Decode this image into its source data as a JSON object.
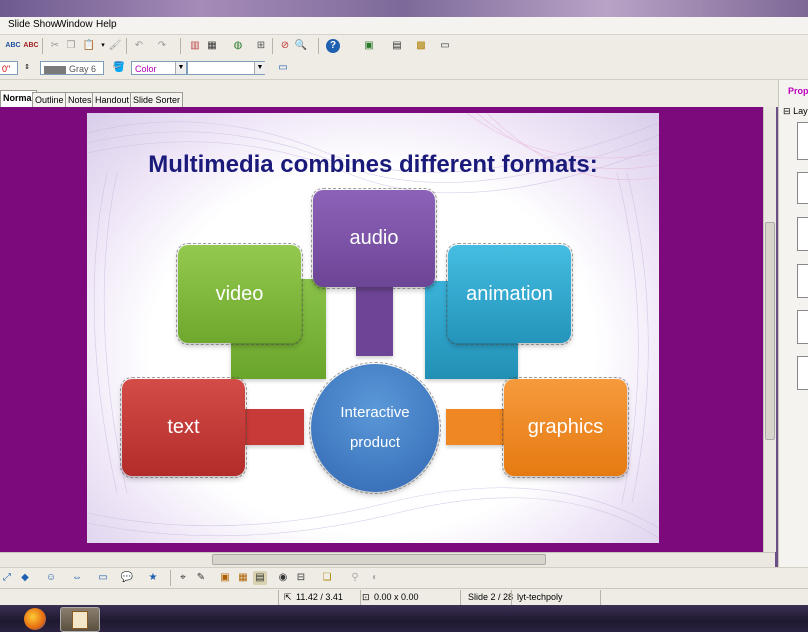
{
  "menu": {
    "slide_show": "Slide Show",
    "window": "Window",
    "help": "Help"
  },
  "toolbar2": {
    "zoom_value": "0\"",
    "fill_color": "Gray 6",
    "area_style": "Color",
    "area_value": ""
  },
  "tabs": [
    "Normal",
    "Outline",
    "Notes",
    "Handout",
    "Slide Sorter"
  ],
  "side_panel": {
    "title": "Prope",
    "section": "Lay"
  },
  "slide": {
    "title": "Multimedia combines different formats:",
    "center": "Interactive\nproduct",
    "center_line1": "Interactive",
    "center_line2": "product",
    "audio": "audio",
    "video": "video",
    "animation": "animation",
    "text": "text",
    "graphics": "graphics"
  },
  "status": {
    "position": "11.42 / 3.41",
    "size": "0.00 x 0.00",
    "slide": "Slide 2 / 28",
    "layout": "lyt-techpoly"
  },
  "colors": {
    "workspace": "#7d0a7d",
    "title_text": "#1a1a7a",
    "audio": "#7a4fa4",
    "video": "#7db73b",
    "animation": "#2fa9cf",
    "text": "#c73a37",
    "graphics": "#ef8722",
    "center": "#3f7fc8"
  }
}
